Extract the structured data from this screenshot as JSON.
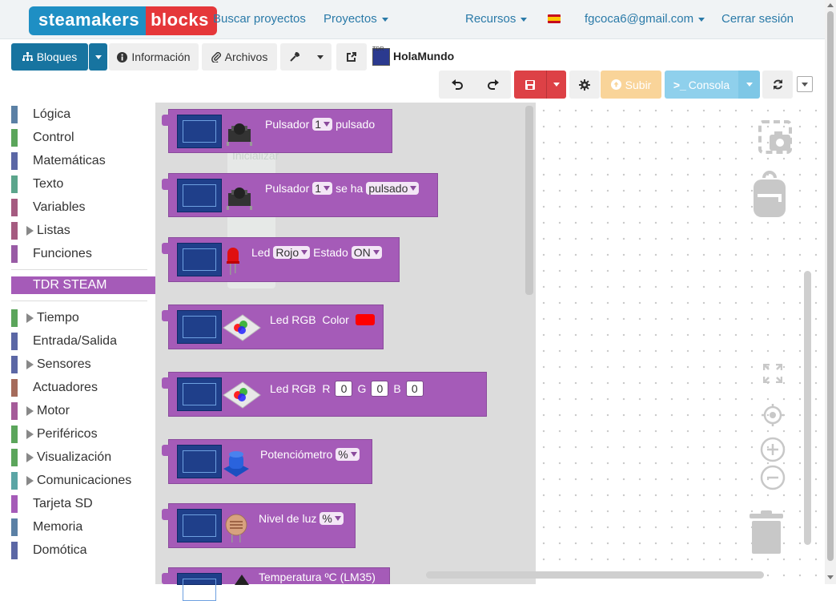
{
  "navbar": {
    "logo_left": "steamakers",
    "logo_right": "blocks",
    "search_projects": "Buscar proyectos",
    "projects": "Proyectos",
    "resources": "Recursos",
    "user_email": "fgcoca6@gmail.com",
    "logout": "Cerrar sesión"
  },
  "toolbar": {
    "blocks_label": "Bloques",
    "info_label": "Información",
    "files_label": "Archivos",
    "project_badge": "TDR",
    "project_title": "HolaMundo",
    "upload_label": "Subir",
    "console_label": "Consola"
  },
  "categories": [
    {
      "label": "Lógica",
      "color": "#5b80a5",
      "expandable": false
    },
    {
      "label": "Control",
      "color": "#5ba55b",
      "expandable": false
    },
    {
      "label": "Matemáticas",
      "color": "#5b67a5",
      "expandable": false
    },
    {
      "label": "Texto",
      "color": "#5ba58c",
      "expandable": false
    },
    {
      "label": "Variables",
      "color": "#a55b80",
      "expandable": false
    },
    {
      "label": "Listas",
      "color": "#a55b80",
      "expandable": true
    },
    {
      "label": "Funciones",
      "color": "#995ba5",
      "expandable": false
    }
  ],
  "active_category": "TDR STEAM",
  "categories2": [
    {
      "label": "Tiempo",
      "color": "#5ba55b",
      "expandable": true
    },
    {
      "label": "Entrada/Salida",
      "color": "#5b67a5",
      "expandable": false
    },
    {
      "label": "Sensores",
      "color": "#5b67a5",
      "expandable": true
    },
    {
      "label": "Actuadores",
      "color": "#a56b5b",
      "expandable": false
    },
    {
      "label": "Motor",
      "color": "#a55b99",
      "expandable": true
    },
    {
      "label": "Periféricos",
      "color": "#5ba55b",
      "expandable": true
    },
    {
      "label": "Visualización",
      "color": "#5ba55b",
      "expandable": true
    },
    {
      "label": "Comunicaciones",
      "color": "#5ba5a5",
      "expandable": true
    },
    {
      "label": "Tarjeta SD",
      "color": "#a55bb8",
      "expandable": false
    },
    {
      "label": "Memoria",
      "color": "#5b80a5",
      "expandable": false
    },
    {
      "label": "Domótica",
      "color": "#5b67a5",
      "expandable": false
    }
  ],
  "ghost_label": "Inicializar",
  "blocks": {
    "b1": {
      "label": "Pulsador",
      "pin": "1",
      "suffix": "pulsado"
    },
    "b2": {
      "label": "Pulsador",
      "pin": "1",
      "mid": "se ha",
      "state": "pulsado"
    },
    "b3": {
      "label": "Led",
      "color": "Rojo",
      "mid": "Estado",
      "state": "ON"
    },
    "b4": {
      "label": "Led RGB  Color",
      "swatch": "#ff0000"
    },
    "b5": {
      "label": "Led RGB  R",
      "r": "0",
      "g_label": "G",
      "g": "0",
      "b_label": "B",
      "b": "0"
    },
    "b6": {
      "label": "Potenciómetro",
      "unit": "%"
    },
    "b7": {
      "label": "Nivel de luz",
      "unit": "%"
    },
    "b8": {
      "label": "Temperatura ºC (LM35)"
    }
  }
}
